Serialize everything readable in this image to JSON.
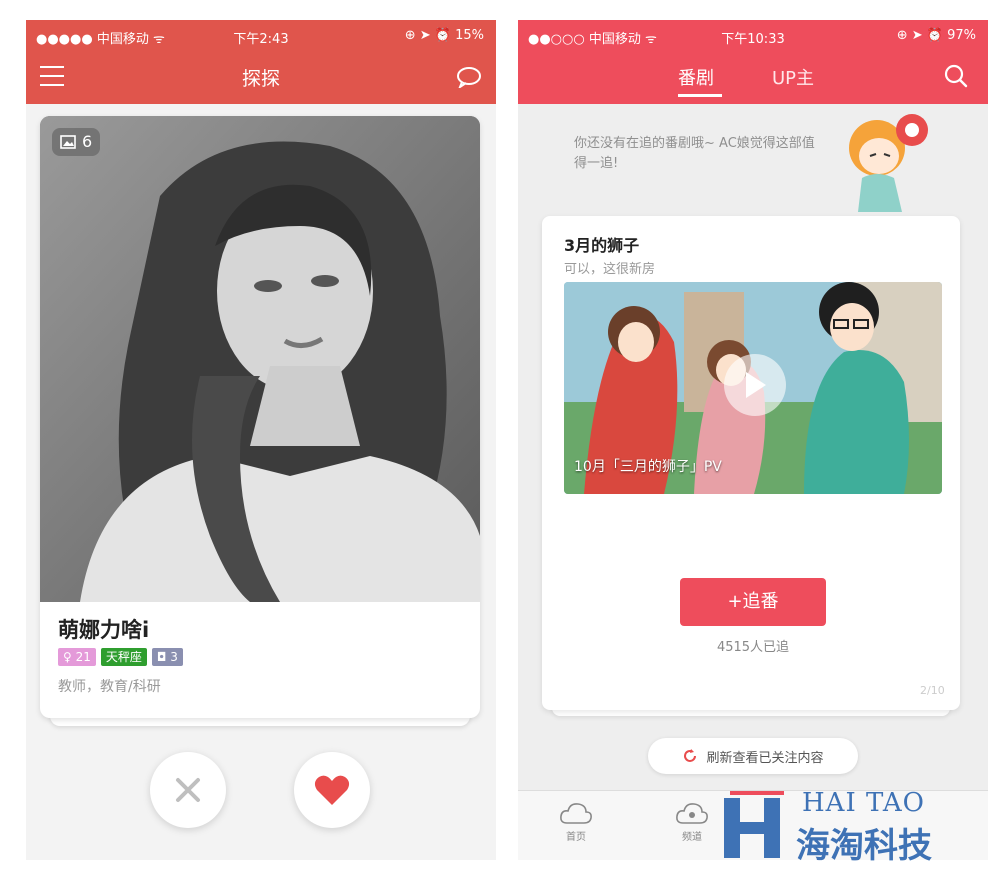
{
  "colors": {
    "left_header": "#e0554c",
    "right_header": "#ee4d5c",
    "like_heart": "#e84c4c",
    "tag_pink": "#e49ad9",
    "tag_green": "#2f9e2f",
    "tag_purple": "#8a8fb0",
    "watermark_blue": "#3e72b5"
  },
  "left": {
    "status": {
      "carrier": "●●●●● 中国移动 ᯤ",
      "time": "下午2:43",
      "right": "⊕ ➤ ⏰ 15%"
    },
    "nav": {
      "title": "探探",
      "menu_icon": "hamburger-icon",
      "chat_icon": "chat-bubble-icon"
    },
    "card": {
      "photo_count": "6",
      "name": "萌娜力啥i",
      "tags": [
        {
          "text": "♀ 21",
          "color": "#e49ad9"
        },
        {
          "text": "天秤座",
          "color": "#2f9e2f"
        },
        {
          "text": "◘ 3",
          "color": "#8a8fb0"
        }
      ],
      "job": "教师，教育/科研"
    },
    "actions": {
      "dislike_icon": "close-x-icon",
      "like_icon": "heart-icon"
    }
  },
  "right": {
    "status": {
      "carrier": "●●○○○ 中国移动 ᯤ",
      "time": "下午10:33",
      "right": "⊕ ➤ ⏰ 97%"
    },
    "tabs": [
      {
        "label": "番剧",
        "active": true
      },
      {
        "label": "UP主",
        "active": false
      }
    ],
    "search_icon": "search-icon",
    "empty_tip": "你还没有在追的番剧哦~ AC娘觉得这部值得一追!",
    "anime": {
      "title": "3月的狮子",
      "subtitle": "可以，这很新房",
      "video_caption": "10月「三月的狮子」PV",
      "follow_label": "+追番",
      "follow_count": "4515人已追",
      "page_indicator": "2/10"
    },
    "refresh_label": "刷新查看已关注内容",
    "bottom_nav": [
      {
        "label": "首页"
      },
      {
        "label": "频道"
      }
    ]
  },
  "watermark": {
    "en": "HAI TAO",
    "cn": "海淘科技"
  }
}
